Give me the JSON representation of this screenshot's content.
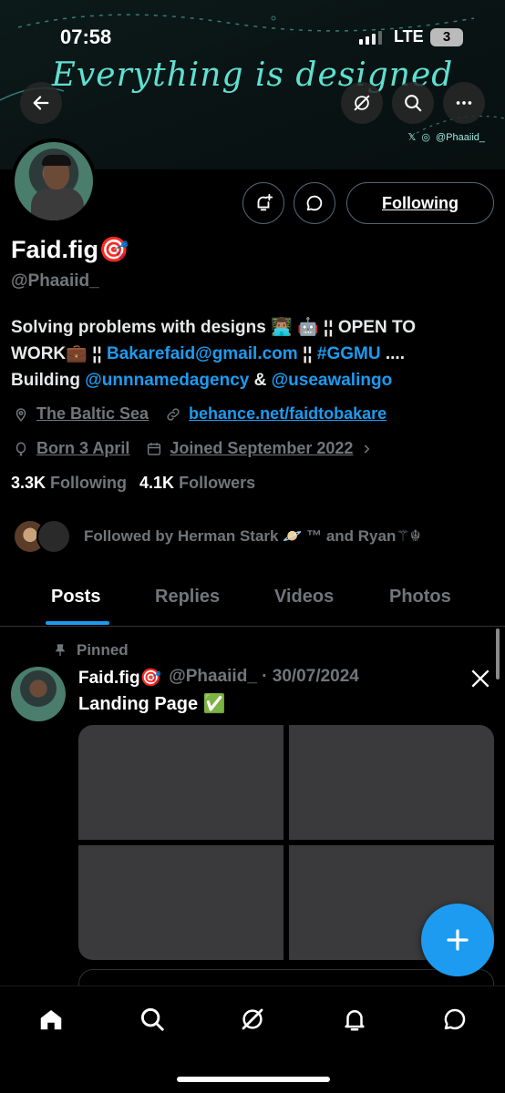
{
  "status": {
    "time": "07:58",
    "network": "LTE",
    "battery": "3"
  },
  "banner": {
    "title": "Everything is designed",
    "handle": "@Phaaiid_"
  },
  "profile": {
    "name": "Faid.fig🎯",
    "handle": "@Phaaiid_",
    "follow_label": "Following",
    "bio_1": "Solving problems with designs 👨🏽‍💻 🤖 ¦¦ OPEN TO",
    "bio_2a": "WORK💼 ¦¦ ",
    "bio_email": "Bakarefaid@gmail.com",
    "bio_2b": " ¦¦ ",
    "bio_tag": "#GGMU",
    "bio_2c": " ....",
    "bio_3a": "Building ",
    "bio_mention1": "@unnnamedagency",
    "bio_3b": " & ",
    "bio_mention2": "@useawalingo",
    "location": "The Baltic Sea",
    "website": "behance.net/faidtobakare",
    "born": "Born 3 April",
    "joined": "Joined September 2022",
    "following_count": "3.3K",
    "following_label": "Following",
    "followers_count": "4.1K",
    "followers_label": "Followers",
    "followed_by": "Followed by Herman Stark 🪐 ™ and Ryan⚚☬"
  },
  "tabs": [
    "Posts",
    "Replies",
    "Videos",
    "Photos"
  ],
  "post": {
    "pinned_label": "Pinned",
    "author": "Faid.fig🎯",
    "meta": "@Phaaiid_ · 30/07/2024",
    "text": "Landing Page ✅"
  },
  "colors": {
    "accent": "#1d9bf0",
    "banner_text": "#5ee0d1",
    "background": "#000000",
    "muted": "#71767b"
  }
}
